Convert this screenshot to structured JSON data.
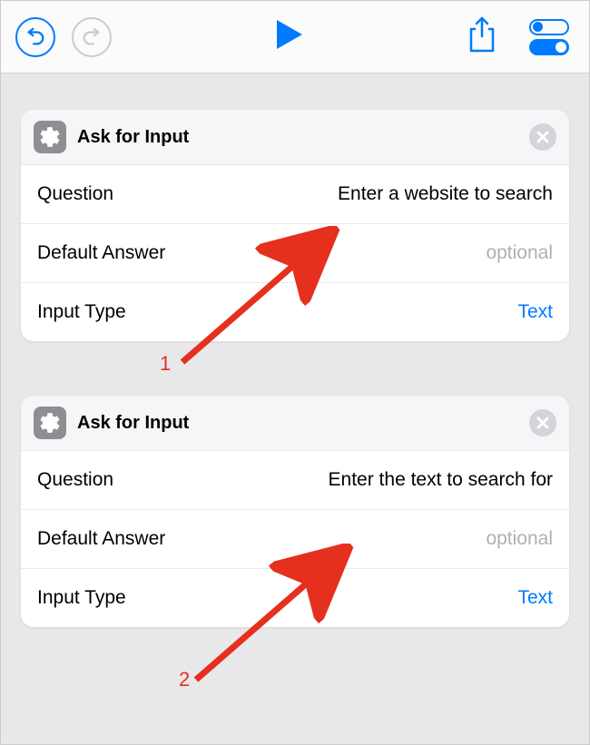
{
  "toolbar": {
    "undo": "undo",
    "redo": "redo",
    "play": "play",
    "share": "share",
    "settings": "settings"
  },
  "cards": [
    {
      "icon": "gear",
      "title": "Ask for Input",
      "rows": {
        "question_label": "Question",
        "question_value": "Enter a website to search",
        "default_label": "Default Answer",
        "default_placeholder": "optional",
        "type_label": "Input Type",
        "type_value": "Text"
      }
    },
    {
      "icon": "gear",
      "title": "Ask for Input",
      "rows": {
        "question_label": "Question",
        "question_value": "Enter the text to search for",
        "default_label": "Default Answer",
        "default_placeholder": "optional",
        "type_label": "Input Type",
        "type_value": "Text"
      }
    }
  ],
  "annotations": {
    "one": "1",
    "two": "2"
  }
}
